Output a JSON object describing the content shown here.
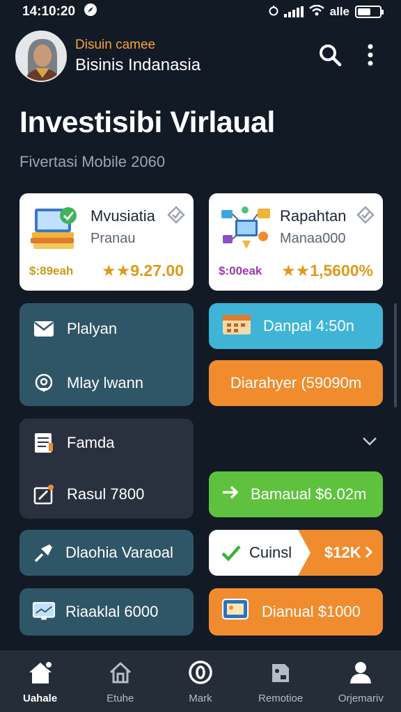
{
  "status": {
    "time": "14:10:20",
    "carrier": "alle"
  },
  "profile": {
    "subtitle": "Disuin camee",
    "name": "Bisinis Indanasia"
  },
  "hero": {
    "title": "Investisibi Virlaual",
    "subtitle": "Fivertasi Mobile 2060"
  },
  "featured": [
    {
      "title": "Mvusiatia",
      "subtitle": "Pranau",
      "tag": "$:89eah",
      "rating": "★★9.27.00",
      "tag_color": "#c79a12"
    },
    {
      "title": "Rapahtan",
      "subtitle": "Manaa000",
      "tag": "$:00eak",
      "rating": "★★1,5600%",
      "tag_color": "#9a3aa8"
    }
  ],
  "left_tiles": {
    "group1": [
      {
        "label": "Plalyan",
        "icon": "mail-icon"
      },
      {
        "label": "Mlay lwann",
        "icon": "location-icon"
      }
    ],
    "group2": [
      {
        "label": "Famda",
        "icon": "document-icon"
      },
      {
        "label": "Rasul 7800",
        "icon": "edit-icon"
      }
    ],
    "tile3": {
      "label": "Dlaohia Varaoal",
      "icon": "pin-icon"
    },
    "tile4": {
      "label": "Riaaklal 6000",
      "icon": "monitor-icon"
    }
  },
  "right_tiles": {
    "danpal": {
      "label": "Danpal 4:50n",
      "icon": "calendar-icon",
      "color": "#3fb4d6"
    },
    "diarahyer": {
      "label": "Diarahyer (59090m",
      "color": "#f08c2e"
    },
    "bamaual": {
      "label": "Bamaual $6.02m",
      "color": "#5ec23e"
    },
    "cuinsl": {
      "label": "Cuinsl",
      "amount": "$12K"
    },
    "dianual": {
      "label": "Dianual $1000",
      "icon": "screen-icon",
      "color": "#f08c2e"
    }
  },
  "nav": [
    {
      "label": "Uahale",
      "icon": "home-icon"
    },
    {
      "label": "Etuhe",
      "icon": "house-icon"
    },
    {
      "label": "Mark",
      "icon": "circle-icon"
    },
    {
      "label": "Remotioe",
      "icon": "remote-icon"
    },
    {
      "label": "Orjemariv",
      "icon": "user-icon"
    }
  ],
  "colors": {
    "background": "#121a26",
    "accent": "#f2a33a",
    "tile_teal": "#2f5666",
    "tile_dark": "#2a313e"
  }
}
